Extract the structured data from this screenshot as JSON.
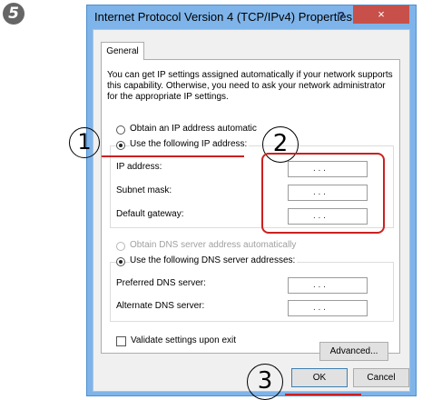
{
  "step_number": "5",
  "window": {
    "title": "Internet Protocol Version 4 (TCP/IPv4) Properties",
    "help_label": "?",
    "close_label": "×"
  },
  "tab": {
    "label": "General"
  },
  "description": "You can get IP settings assigned automatically if your network supports this capability. Otherwise, you need to ask your network administrator for the appropriate IP settings.",
  "ip_section": {
    "auto_label": "Obtain an IP address automatic",
    "manual_label": "Use the following IP address:",
    "selected": "manual",
    "fields": [
      {
        "label": "IP address:",
        "value": ".     .     ."
      },
      {
        "label": "Subnet mask:",
        "value": ".     .     ."
      },
      {
        "label": "Default gateway:",
        "value": ".     .     ."
      }
    ]
  },
  "dns_section": {
    "auto_label": "Obtain DNS server address automatically",
    "manual_label": "Use the following DNS server addresses:",
    "selected": "manual",
    "fields": [
      {
        "label": "Preferred DNS server:",
        "value": ".     .     ."
      },
      {
        "label": "Alternate DNS server:",
        "value": ".     .     ."
      }
    ]
  },
  "validate": {
    "label": "Validate settings upon exit",
    "checked": false
  },
  "buttons": {
    "advanced": "Advanced...",
    "ok": "OK",
    "cancel": "Cancel"
  },
  "annotations": {
    "one": "1",
    "two": "2",
    "three": "3",
    "highlight_color": "#cc2020"
  }
}
